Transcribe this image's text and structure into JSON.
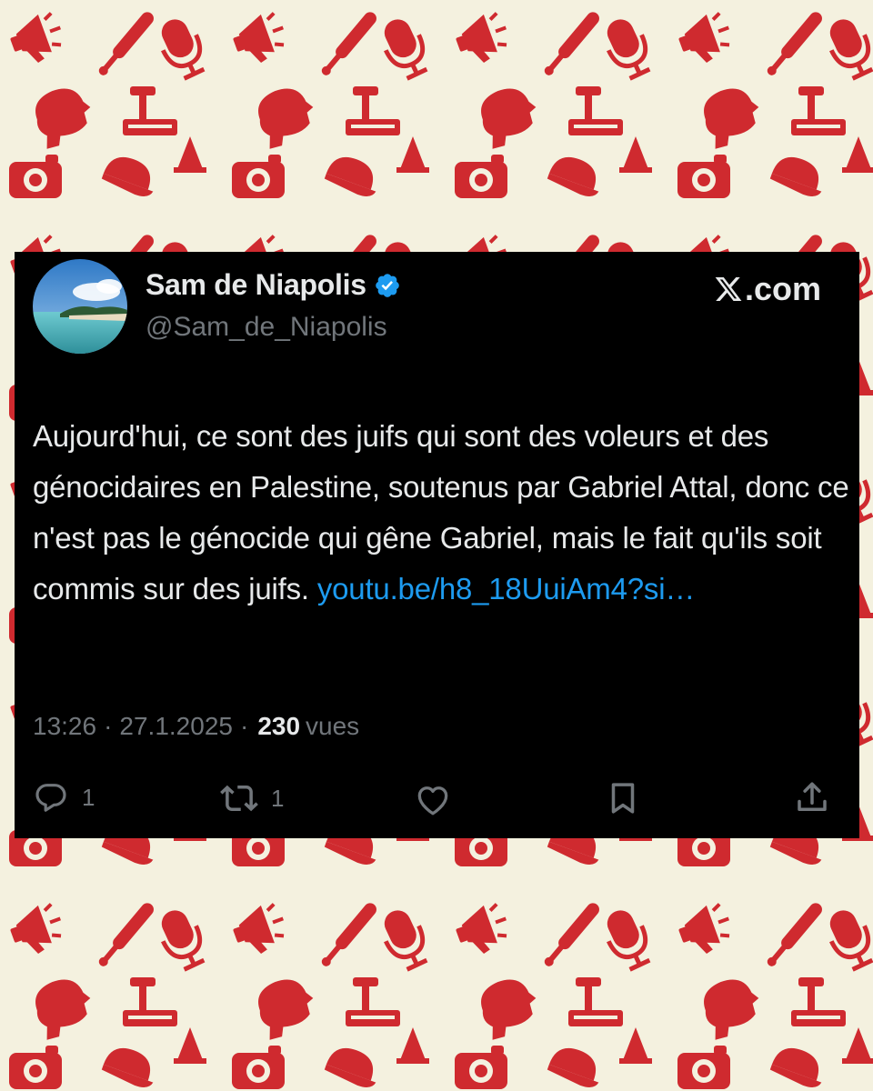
{
  "post": {
    "display_name": "Sam de Niapolis",
    "handle": "@Sam_de_Niapolis",
    "brand": ".com",
    "text": "Aujourd'hui, ce sont des juifs qui sont des voleurs et des génocidaires en Palestine, soutenus par Gabriel Attal, donc ce n'est pas le génocide qui gêne Gabriel, mais le fait qu'ils soit commis sur des juifs. ",
    "link_text": "youtu.be/h8_18UuiAm4?si…",
    "time": "13:26",
    "date": "27.1.2025",
    "separator": "·",
    "views_count": "230",
    "views_label": "vues"
  },
  "actions": {
    "reply_count": "1",
    "repost_count": "1"
  },
  "icons": {
    "verified": "verified-badge-icon",
    "brand": "x-logo-icon",
    "reply": "reply-icon",
    "repost": "repost-icon",
    "like": "like-icon",
    "bookmark": "bookmark-icon",
    "share": "share-icon"
  },
  "colors": {
    "card_bg": "#000000",
    "text": "#e7e9ea",
    "muted": "#71767b",
    "link": "#1d9bf0",
    "verified": "#1d9bf0",
    "pattern_bg": "#f4f1df",
    "pattern_icons": "#cf2a2f"
  }
}
